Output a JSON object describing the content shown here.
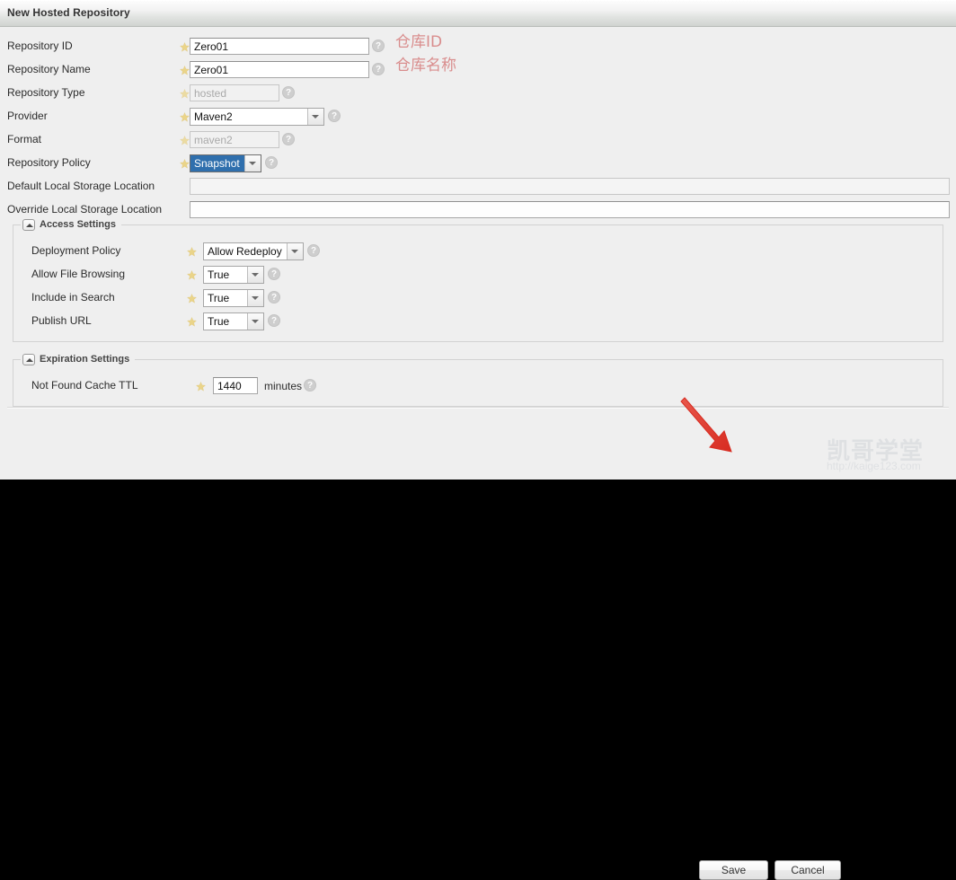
{
  "window": {
    "title": "New Hosted Repository"
  },
  "form": {
    "fields": [
      {
        "label": "Repository ID",
        "value": "Zero01",
        "control": "text",
        "required": true,
        "disabled": false,
        "help": "?"
      },
      {
        "label": "Repository Name",
        "value": "Zero01",
        "control": "text",
        "required": true,
        "disabled": false,
        "help": "?"
      },
      {
        "label": "Repository Type",
        "value": "hosted",
        "control": "text",
        "required": true,
        "disabled": true,
        "help": "?"
      },
      {
        "label": "Provider",
        "value": "Maven2",
        "control": "select",
        "required": true,
        "disabled": false,
        "help": "?"
      },
      {
        "label": "Format",
        "value": "maven2",
        "control": "text",
        "required": true,
        "disabled": true,
        "help": "?"
      },
      {
        "label": "Repository Policy",
        "value": "Snapshot",
        "control": "select",
        "required": true,
        "disabled": false,
        "help": "?",
        "highlighted": true
      },
      {
        "label": "Default Local Storage Location",
        "value": "",
        "control": "text",
        "required": false,
        "disabled": true,
        "help": ""
      },
      {
        "label": "Override Local Storage Location",
        "value": "",
        "control": "text",
        "required": false,
        "disabled": false,
        "help": ""
      }
    ]
  },
  "access_settings": {
    "legend": "Access Settings",
    "fields": [
      {
        "label": "Deployment Policy",
        "value": "Allow Redeploy",
        "control": "select",
        "required": true,
        "help": "?"
      },
      {
        "label": "Allow File Browsing",
        "value": "True",
        "control": "select",
        "required": true,
        "help": "?"
      },
      {
        "label": "Include in Search",
        "value": "True",
        "control": "select",
        "required": true,
        "help": "?"
      },
      {
        "label": "Publish URL",
        "value": "True",
        "control": "select",
        "required": true,
        "help": "?"
      }
    ]
  },
  "expiration_settings": {
    "legend": "Expiration Settings",
    "fields": [
      {
        "label": "Not Found Cache TTL",
        "value": "1440",
        "unit": "minutes",
        "control": "text",
        "required": true,
        "help": "?"
      }
    ]
  },
  "footer": {
    "save_label": "Save",
    "cancel_label": "Cancel"
  },
  "annotations": {
    "repository_id": "仓库ID",
    "repository_name": "仓库名称",
    "arrow_color": "#e03a2f"
  },
  "watermark": {
    "brand": "凯哥学堂",
    "url": "http://kaige123.com"
  },
  "colors": {
    "page_bg": "#efefef",
    "title_bar": "#e3e5e3",
    "selection_blue": "#2f6fad",
    "required_star": "#e8c54b",
    "annotation_red": "#d98d8d"
  }
}
